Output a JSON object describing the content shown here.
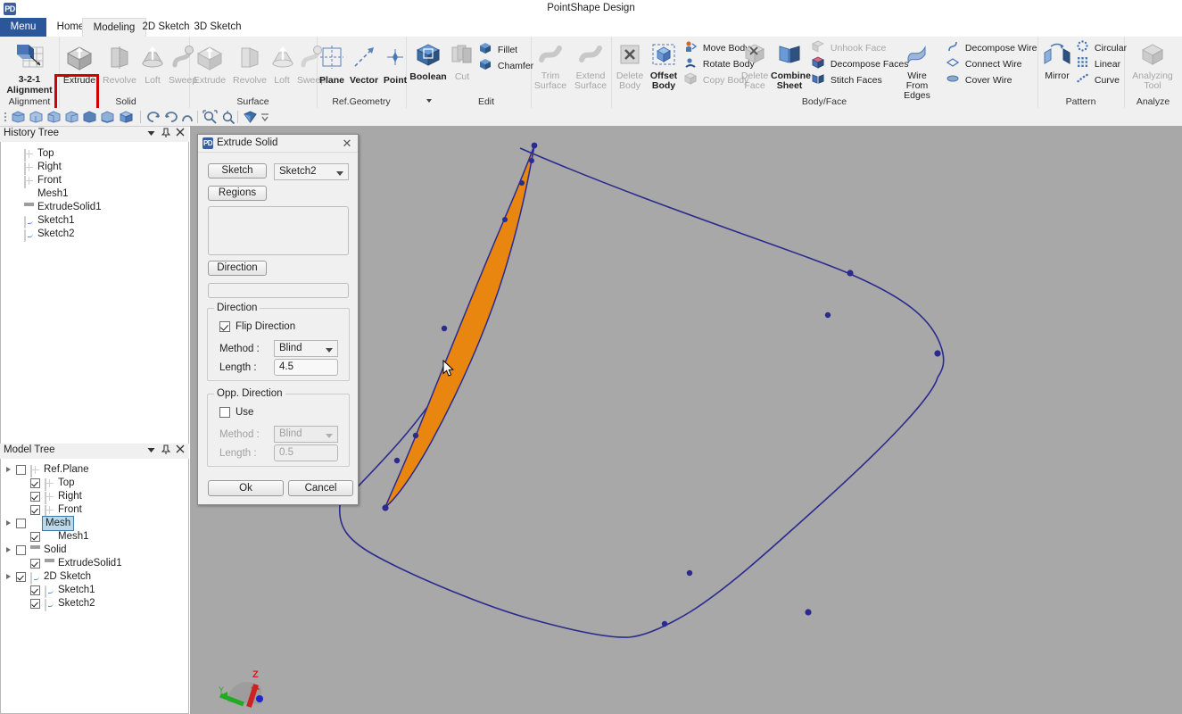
{
  "app": {
    "title": "PointShape Design",
    "logo_text": "PD"
  },
  "tabs": {
    "menu_label": "Menu",
    "items": [
      {
        "label": "Home",
        "active": false
      },
      {
        "label": "Modeling",
        "active": true
      },
      {
        "label": "2D Sketch",
        "active": false
      },
      {
        "label": "3D Sketch",
        "active": false
      }
    ]
  },
  "ribbon": {
    "highlight_color": "#d00000",
    "groups": [
      {
        "name": "Alignment",
        "label": "Alignment",
        "buttons": [
          {
            "label": "3-2-1 Alignment",
            "icon": "alignment-icon",
            "enabled": true,
            "bold": false
          }
        ]
      },
      {
        "name": "Solid",
        "label": "Solid",
        "buttons": [
          {
            "label": "Extrude",
            "icon": "extrude-solid-icon",
            "enabled": true,
            "highlighted": true
          },
          {
            "label": "Revolve",
            "icon": "revolve-solid-icon",
            "enabled": false
          },
          {
            "label": "Loft",
            "icon": "loft-solid-icon",
            "enabled": false
          },
          {
            "label": "Sweep",
            "icon": "sweep-solid-icon",
            "enabled": false
          }
        ]
      },
      {
        "name": "Surface",
        "label": "Surface",
        "buttons": [
          {
            "label": "Extrude",
            "icon": "extrude-surface-icon",
            "enabled": false
          },
          {
            "label": "Revolve",
            "icon": "revolve-surface-icon",
            "enabled": false
          },
          {
            "label": "Loft",
            "icon": "loft-surface-icon",
            "enabled": false
          },
          {
            "label": "Sweep",
            "icon": "sweep-surface-icon",
            "enabled": false
          }
        ]
      },
      {
        "name": "Ref.Geometry",
        "label": "Ref.Geometry",
        "buttons": [
          {
            "label": "Plane",
            "icon": "plane-icon",
            "enabled": true
          },
          {
            "label": "Vector",
            "icon": "vector-icon",
            "enabled": true
          },
          {
            "label": "Point",
            "icon": "point-icon",
            "enabled": true
          }
        ]
      },
      {
        "name": "Edit",
        "label": "Edit",
        "buttons": [
          {
            "label": "Boolean",
            "icon": "boolean-icon",
            "enabled": true,
            "has_dropdown": true
          },
          {
            "label": "Cut",
            "icon": "cut-icon",
            "enabled": false
          }
        ],
        "small_buttons": [
          {
            "label": "Fillet",
            "icon": "fillet-icon",
            "enabled": true
          },
          {
            "label": "Chamfer",
            "icon": "chamfer-icon",
            "enabled": true
          }
        ]
      },
      {
        "name": "Surface2",
        "label": "",
        "buttons": [
          {
            "label": "Trim Surface",
            "icon": "trim-surface-icon",
            "enabled": false
          },
          {
            "label": "Extend Surface",
            "icon": "extend-surface-icon",
            "enabled": false
          }
        ]
      },
      {
        "name": "Body/Face",
        "label": "Body/Face",
        "buttons": [
          {
            "label": "Delete Body",
            "icon": "delete-body-icon",
            "enabled": false
          },
          {
            "label": "Offset Body",
            "icon": "offset-body-icon",
            "enabled": true,
            "bold": true
          },
          {
            "label": "Delete Face",
            "icon": "delete-face-icon",
            "enabled": false
          },
          {
            "label": "Combine Sheet",
            "icon": "combine-sheet-icon",
            "enabled": true,
            "bold": true
          },
          {
            "label": "Wire From Edges",
            "icon": "wire-from-edges-icon",
            "enabled": true
          }
        ],
        "small_buttons": [
          {
            "label": "Move Body",
            "icon": "move-body-icon",
            "enabled": true
          },
          {
            "label": "Rotate Body",
            "icon": "rotate-body-icon",
            "enabled": true
          },
          {
            "label": "Copy Body",
            "icon": "copy-body-icon",
            "enabled": false
          },
          {
            "label": "Unhook Face",
            "icon": "unhook-face-icon",
            "enabled": false
          },
          {
            "label": "Decompose Faces",
            "icon": "decompose-faces-icon",
            "enabled": true
          },
          {
            "label": "Stitch Faces",
            "icon": "stitch-faces-icon",
            "enabled": true
          },
          {
            "label": "Decompose Wire",
            "icon": "decompose-wire-icon",
            "enabled": true
          },
          {
            "label": "Connect Wire",
            "icon": "connect-wire-icon",
            "enabled": true
          },
          {
            "label": "Cover Wire",
            "icon": "cover-wire-icon",
            "enabled": true
          }
        ]
      },
      {
        "name": "Pattern",
        "label": "Pattern",
        "buttons": [
          {
            "label": "Mirror",
            "icon": "mirror-icon",
            "enabled": true
          }
        ],
        "small_buttons": [
          {
            "label": "Circular",
            "icon": "circular-pattern-icon",
            "enabled": true
          },
          {
            "label": "Linear",
            "icon": "linear-pattern-icon",
            "enabled": true
          },
          {
            "label": "Curve",
            "icon": "curve-pattern-icon",
            "enabled": true
          }
        ]
      },
      {
        "name": "Analyze",
        "label": "Analyze",
        "buttons": [
          {
            "label": "Analyzing Tool",
            "icon": "analyzing-tool-icon",
            "enabled": false
          }
        ]
      }
    ]
  },
  "quickbar": {
    "items": [
      {
        "name": "view-front-icon"
      },
      {
        "name": "view-back-icon"
      },
      {
        "name": "view-left-icon"
      },
      {
        "name": "view-right-icon"
      },
      {
        "name": "view-top-icon"
      },
      {
        "name": "view-bottom-icon"
      },
      {
        "name": "view-iso-icon"
      },
      {
        "name": "rotate-ccw-icon"
      },
      {
        "name": "rotate-cw-icon"
      },
      {
        "name": "rotate-arc-icon"
      },
      {
        "name": "zoom-fit-icon"
      },
      {
        "name": "zoom-window-icon"
      },
      {
        "name": "render-shade-icon"
      },
      {
        "name": "overflow-icon"
      }
    ]
  },
  "history_tree": {
    "title": "History Tree",
    "controls": [
      "dropdown-icon",
      "pin-icon",
      "close-icon"
    ],
    "nodes": [
      {
        "label": "Top",
        "icon": "plane-icon",
        "indent": 26
      },
      {
        "label": "Right",
        "icon": "plane-icon",
        "indent": 26
      },
      {
        "label": "Front",
        "icon": "plane-icon",
        "indent": 26
      },
      {
        "label": "Mesh1",
        "icon": "mesh-icon",
        "indent": 26
      },
      {
        "label": "ExtrudeSolid1",
        "icon": "solid-icon",
        "indent": 26
      },
      {
        "label": "Sketch1",
        "icon": "sketch-icon",
        "indent": 26
      },
      {
        "label": "Sketch2",
        "icon": "sketch-icon",
        "indent": 26
      }
    ]
  },
  "model_tree": {
    "title": "Model Tree",
    "controls": [
      "dropdown-icon",
      "pin-icon",
      "close-icon"
    ],
    "nodes": [
      {
        "label": "Ref.Plane",
        "icon": "plane-icon",
        "level": 0,
        "checked": false,
        "expander": true,
        "selected": false
      },
      {
        "label": "Top",
        "icon": "plane-icon",
        "level": 1,
        "checked": true,
        "expander": false,
        "selected": false
      },
      {
        "label": "Right",
        "icon": "plane-icon",
        "level": 1,
        "checked": true,
        "expander": false,
        "selected": false
      },
      {
        "label": "Front",
        "icon": "plane-icon",
        "level": 1,
        "checked": true,
        "expander": false,
        "selected": false
      },
      {
        "label": "Mesh",
        "icon": "mesh-icon",
        "level": 0,
        "checked": false,
        "expander": true,
        "selected": true
      },
      {
        "label": "Mesh1",
        "icon": "mesh-icon",
        "level": 1,
        "checked": true,
        "expander": false,
        "selected": false
      },
      {
        "label": "Solid",
        "icon": "solid-icon",
        "level": 0,
        "checked": false,
        "expander": true,
        "selected": false
      },
      {
        "label": "ExtrudeSolid1",
        "icon": "solid-icon",
        "level": 1,
        "checked": true,
        "expander": false,
        "selected": false
      },
      {
        "label": "2D Sketch",
        "icon": "sketch-icon",
        "level": 0,
        "checked": true,
        "expander": true,
        "selected": false
      },
      {
        "label": "Sketch1",
        "icon": "sketch-icon",
        "level": 1,
        "checked": true,
        "expander": false,
        "selected": false
      },
      {
        "label": "Sketch2",
        "icon": "sketch-icon",
        "level": 1,
        "checked": true,
        "expander": false,
        "selected": false
      }
    ]
  },
  "dialog": {
    "title": "Extrude Solid",
    "logo_text": "PD",
    "close_label": "✕",
    "sketch_button": "Sketch",
    "sketch_value": "Sketch2",
    "regions_button": "Regions",
    "regions_value": "",
    "direction_button": "Direction",
    "direction_value": "",
    "direction_group": {
      "legend": "Direction",
      "flip_label": "Flip Direction",
      "flip_checked": true,
      "method_label": "Method :",
      "method_value": "Blind",
      "length_label": "Length :",
      "length_value": "4.5"
    },
    "opp_direction_group": {
      "legend": "Opp. Direction",
      "use_label": "Use",
      "use_checked": false,
      "method_label": "Method :",
      "method_value": "Blind",
      "length_label": "Length :",
      "length_value": "0.5"
    },
    "ok_label": "Ok",
    "cancel_label": "Cancel"
  },
  "viewport": {
    "background_color": "#a8a8a8",
    "wire_color": "#2b2b8f",
    "region_fill_color": "#e8860f",
    "region_edge_color": "#2b2b8f",
    "axis_triad": {
      "z_label": "Z",
      "y_label": "Y",
      "z_color": "#cc2222",
      "y_color": "#22aa22",
      "x_color": "#2222cc"
    }
  }
}
